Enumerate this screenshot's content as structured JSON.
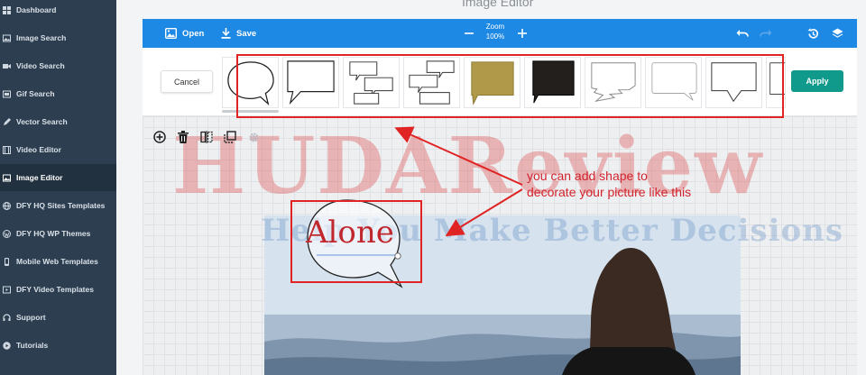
{
  "sidebar": {
    "items": [
      {
        "label": "Dashboard",
        "icon": "dashboard-icon"
      },
      {
        "label": "Image Search",
        "icon": "image-icon"
      },
      {
        "label": "Video Search",
        "icon": "video-camera-icon"
      },
      {
        "label": "Gif Search",
        "icon": "gif-icon"
      },
      {
        "label": "Vector Search",
        "icon": "pen-icon"
      },
      {
        "label": "Video Editor",
        "icon": "film-icon"
      },
      {
        "label": "Image Editor",
        "icon": "image-edit-icon",
        "active": true
      },
      {
        "label": "DFY HQ Sites Templates",
        "icon": "globe-icon"
      },
      {
        "label": "DFY HQ WP Themes",
        "icon": "wordpress-icon"
      },
      {
        "label": "Mobile Web Templates",
        "icon": "mobile-icon"
      },
      {
        "label": "DFY Video Templates",
        "icon": "video-template-icon"
      },
      {
        "label": "Support",
        "icon": "support-icon"
      },
      {
        "label": "Tutorials",
        "icon": "play-circle-icon"
      }
    ]
  },
  "page": {
    "title": "Image Editor"
  },
  "toolbar": {
    "open_label": "Open",
    "save_label": "Save",
    "zoom_label": "Zoom",
    "zoom_value": "100%",
    "accent": "#1e88e5"
  },
  "shape_panel": {
    "cancel_label": "Cancel",
    "apply_label": "Apply",
    "shapes": [
      "round-speech-bubble",
      "square-speech-bubble",
      "stacked-rect-bubbles",
      "stacked-bubbles-alt",
      "gold-banner",
      "black-banner",
      "jagged-bubble",
      "rounded-bubble",
      "pointed-bubble",
      "partial-bubble"
    ]
  },
  "canvas": {
    "shape_text": "Alone",
    "annotation_line1": "you can add shape to",
    "annotation_line2": "decorate your picture like this",
    "watermark_line1": "HUDAReview",
    "watermark_line2": "Help You Make Better Decisions"
  },
  "colors": {
    "sidebar_bg": "#2c3e50",
    "apply_bg": "#0f9a8c",
    "highlight_red": "#e02424"
  }
}
